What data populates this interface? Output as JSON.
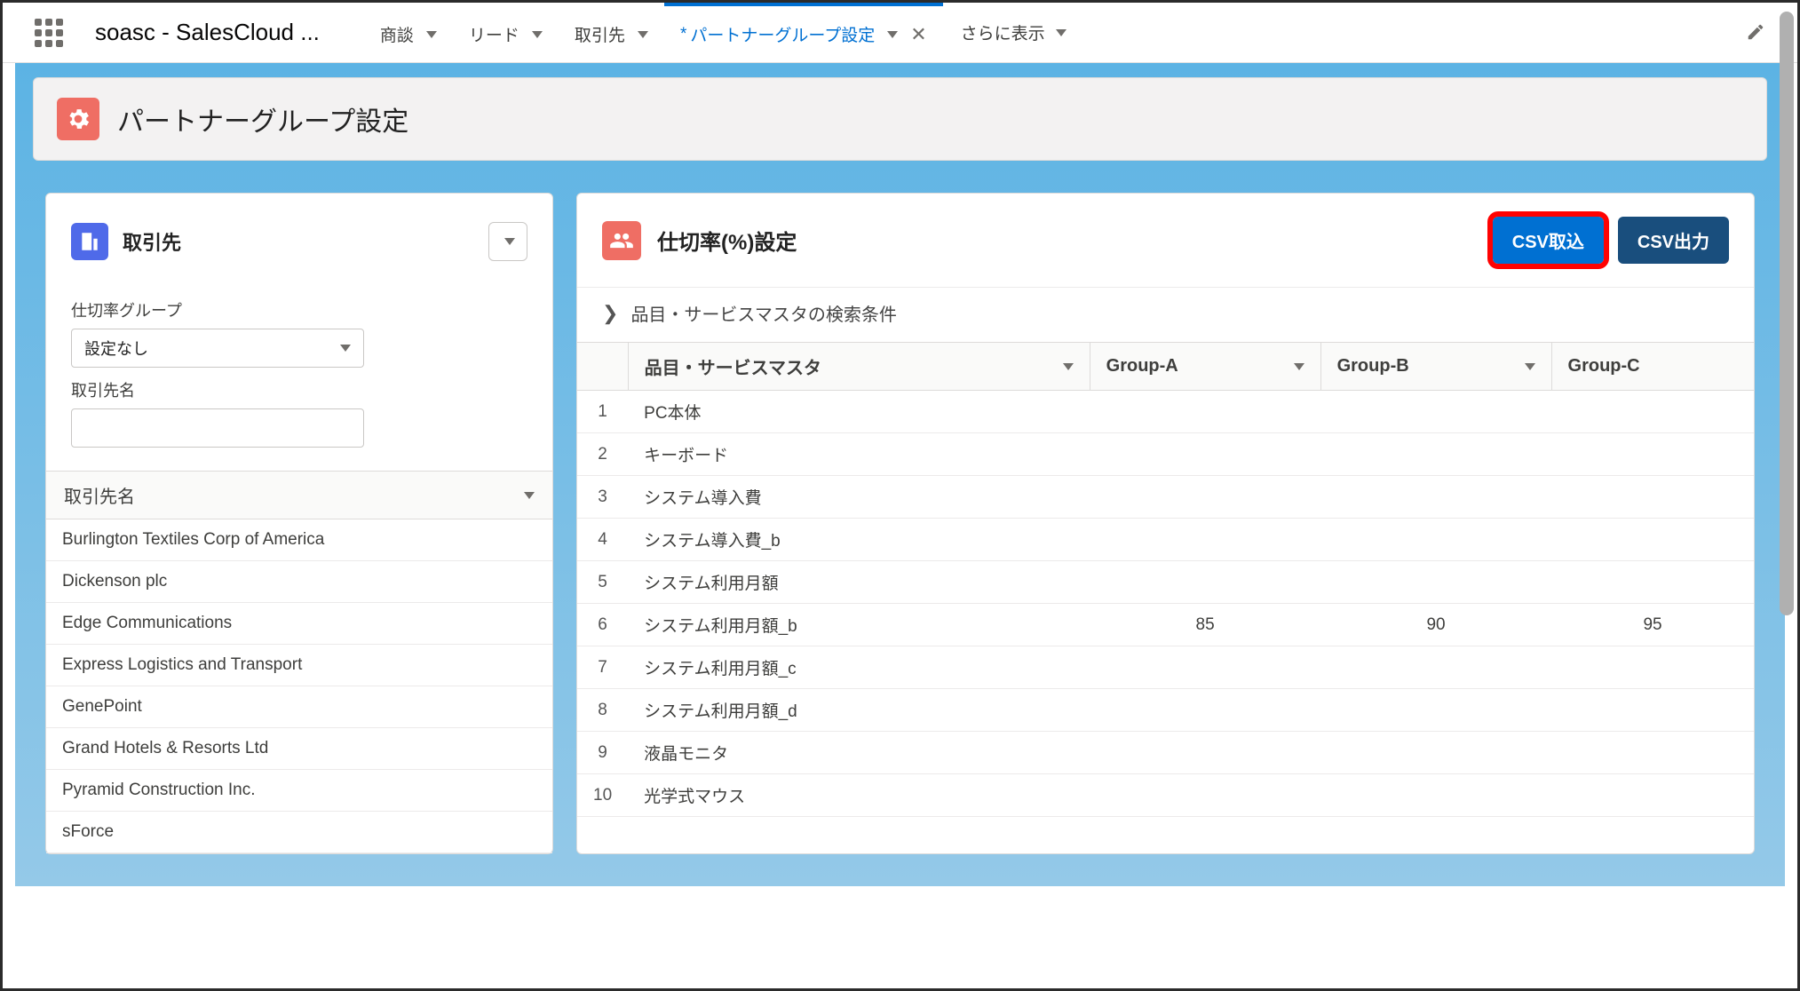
{
  "topbar": {
    "app_name": "soasc - SalesCloud ...",
    "tabs": [
      {
        "label": "商談"
      },
      {
        "label": "リード"
      },
      {
        "label": "取引先"
      },
      {
        "label": "パートナーグループ設定",
        "active": true,
        "starred": true,
        "closable": true
      }
    ],
    "more_label": "さらに表示"
  },
  "page_header": {
    "title": "パートナーグループ設定"
  },
  "left_panel": {
    "title": "取引先",
    "group_label": "仕切率グループ",
    "group_value": "設定なし",
    "name_label": "取引先名",
    "name_value": "",
    "list_header": "取引先名",
    "accounts": [
      "Burlington Textiles Corp of America",
      "Dickenson plc",
      "Edge Communications",
      "Express Logistics and Transport",
      "GenePoint",
      "Grand Hotels & Resorts Ltd",
      "Pyramid Construction Inc.",
      "sForce"
    ]
  },
  "right_panel": {
    "title": "仕切率(%)設定",
    "import_label": "CSV取込",
    "export_label": "CSV出力",
    "search_label": "品目・サービスマスタの検索条件",
    "columns": [
      "品目・サービスマスタ",
      "Group-A",
      "Group-B",
      "Group-C"
    ],
    "rows": [
      {
        "n": "1",
        "item": "PC本体",
        "a": "",
        "b": "",
        "c": ""
      },
      {
        "n": "2",
        "item": "キーボード",
        "a": "",
        "b": "",
        "c": ""
      },
      {
        "n": "3",
        "item": "システム導入費",
        "a": "",
        "b": "",
        "c": ""
      },
      {
        "n": "4",
        "item": "システム導入費_b",
        "a": "",
        "b": "",
        "c": ""
      },
      {
        "n": "5",
        "item": "システム利用月額",
        "a": "",
        "b": "",
        "c": ""
      },
      {
        "n": "6",
        "item": "システム利用月額_b",
        "a": "85",
        "b": "90",
        "c": "95"
      },
      {
        "n": "7",
        "item": "システム利用月額_c",
        "a": "",
        "b": "",
        "c": ""
      },
      {
        "n": "8",
        "item": "システム利用月額_d",
        "a": "",
        "b": "",
        "c": ""
      },
      {
        "n": "9",
        "item": "液晶モニタ",
        "a": "",
        "b": "",
        "c": ""
      },
      {
        "n": "10",
        "item": "光学式マウス",
        "a": "",
        "b": "",
        "c": ""
      }
    ]
  }
}
